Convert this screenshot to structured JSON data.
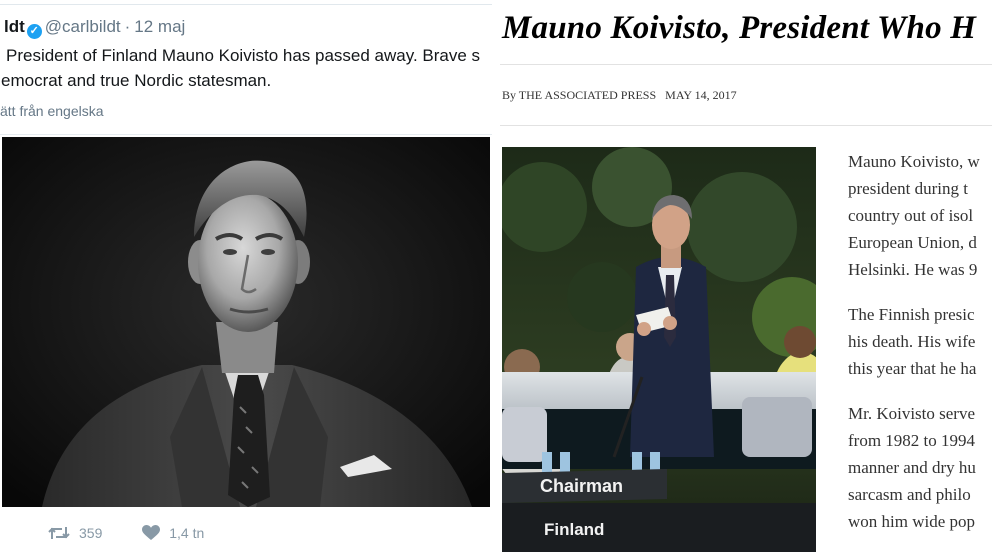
{
  "tweet": {
    "name": "ldt",
    "handle": "@carlbildt",
    "separator": "·",
    "date": "12 maj",
    "text_lines": [
      "President of Finland Mauno Koivisto has passed away. Brave s",
      "emocrat and true Nordic statesman."
    ],
    "translate_link": "ätt från engelska",
    "retweet_count": "359",
    "like_count": "1,4 tn",
    "icons": {
      "verified": "verified-badge-icon",
      "retweet": "retweet-icon",
      "like": "heart-icon"
    },
    "colors": {
      "verified": "#1da1f2",
      "secondary_text": "#657786",
      "action": "#8899a6"
    }
  },
  "article": {
    "headline": "Mauno Koivisto, President Who H",
    "byline": "By THE ASSOCIATED PRESS",
    "date": "MAY 14, 2017",
    "photo_signs": {
      "chairman": "Chairman",
      "country": "Finland"
    },
    "paragraphs": [
      [
        "Mauno Koivisto, w",
        "president during t",
        "country out of isol",
        "European Union, d",
        "Helsinki. He was 9"
      ],
      [
        "The Finnish presic",
        "his death. His wife",
        "this year that he ha"
      ],
      [
        "Mr. Koivisto serve",
        "from 1982 to 1994",
        "manner and dry hu",
        "sarcasm and philo",
        "won him wide pop"
      ]
    ]
  }
}
